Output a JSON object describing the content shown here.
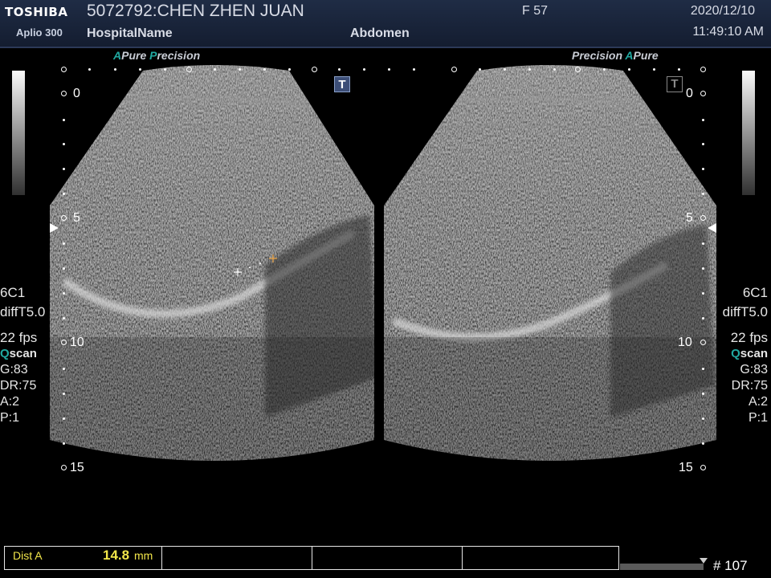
{
  "header": {
    "brand": "TOSHIBA",
    "model": "Aplio 300",
    "patient": "5072792:CHEN ZHEN JUAN",
    "hospital": "HospitalName",
    "sex_age": "F  57",
    "exam": "Abdomen",
    "date": "2020/12/10",
    "time": "11:49:10 AM"
  },
  "left_pane": {
    "pp_label_1_a": "A",
    "pp_label_1_b": "Pure",
    "pp_label_2_a": "P",
    "pp_label_2_b": "recision",
    "depth_marks": [
      "0",
      "5",
      "10",
      "15"
    ],
    "probe": "6C1",
    "mode": "diffT5.0",
    "fps": "22 fps",
    "qscan_q": "Q",
    "qscan_rest": "scan",
    "gain": "G:83",
    "dr": "DR:75",
    "a": "A:2",
    "p": "P:1",
    "t_marker": "T"
  },
  "right_pane": {
    "pp_label_1": "Precision",
    "pp_label_2_a": "A",
    "pp_label_2_b": "Pure",
    "depth_marks": [
      "0",
      "5",
      "10",
      "15"
    ],
    "probe": "6C1",
    "mode": "diffT5.0",
    "fps": "22 fps",
    "qscan_q": "Q",
    "qscan_rest": "scan",
    "gain": "G:83",
    "dr": "DR:75",
    "a": "A:2",
    "p": "P:1",
    "t_marker": "T"
  },
  "measurement": {
    "label": "Dist A",
    "value": "14.8",
    "unit": "mm"
  },
  "cine": {
    "frame": "# 107"
  },
  "colors": {
    "accent_teal": "#21a9a1",
    "measure_value": "#f2e64a",
    "header_bg": "#1a253c"
  }
}
